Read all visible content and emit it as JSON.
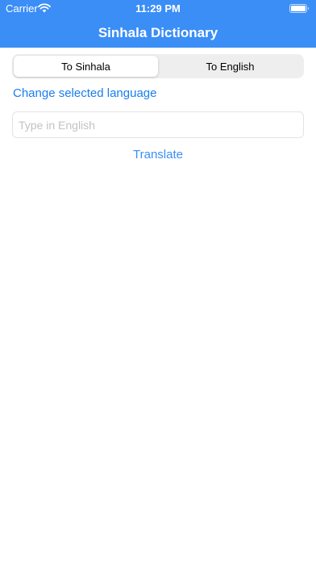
{
  "status_bar": {
    "carrier": "Carrier",
    "time": "11:29 PM",
    "icons": [
      "wifi-icon",
      "battery-icon"
    ]
  },
  "nav": {
    "title": "Sinhala Dictionary",
    "background_color": "#3a8ef6"
  },
  "segmented_control": {
    "segments": [
      {
        "label": "To Sinhala",
        "selected": true
      },
      {
        "label": "To English",
        "selected": false
      }
    ]
  },
  "change_language": {
    "label": "Change selected language"
  },
  "input": {
    "value": "",
    "placeholder": "Type in English"
  },
  "translate_button": {
    "label": "Translate"
  },
  "colors": {
    "accent": "#1a7df0",
    "header": "#3a8ef6"
  }
}
